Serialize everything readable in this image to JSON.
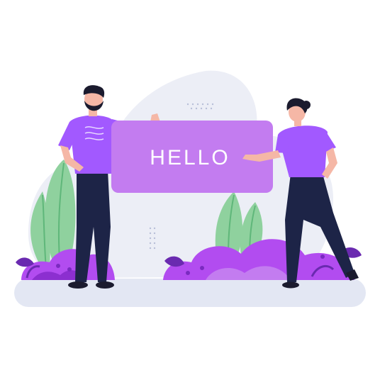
{
  "sign": {
    "text": "HELLO"
  },
  "colors": {
    "blob": "#eceef6",
    "ground": "#e3e7f3",
    "purple": "#a259ff",
    "purple_light": "#c37cf0",
    "purple_dark": "#7a3fd0",
    "bush": "#b24cf0",
    "bush_dark": "#8c2fd0",
    "leaf_green": "#8fd19e",
    "leaf_green_dark": "#5fb77a",
    "pants": "#1d2447",
    "skin": "#f5b7a6",
    "hair": "#1b1b2e"
  },
  "icons": [
    "man-figure",
    "woman-figure",
    "hello-sign",
    "plant-left",
    "plant-right",
    "bush-left",
    "bush-right"
  ]
}
